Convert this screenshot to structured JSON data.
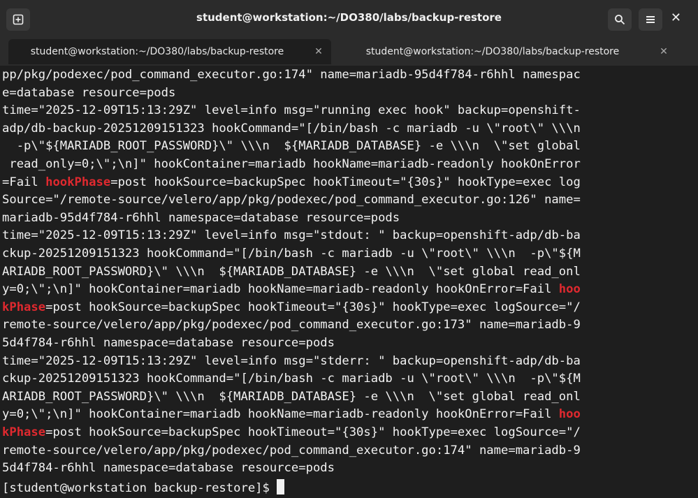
{
  "window": {
    "title": "student@workstation:~/DO380/labs/backup-restore",
    "new_tab_icon": "new-tab-icon",
    "search_icon": "search-icon",
    "menu_icon": "hamburger-menu-icon",
    "close_icon": "close-icon"
  },
  "tabs": [
    {
      "label": "student@workstation:~/DO380/labs/backup-restore",
      "active": true
    },
    {
      "label": "student@workstation:~/DO380/labs/backup-restore",
      "active": false
    }
  ],
  "terminal": {
    "lines": [
      "pp/pkg/podexec/pod_command_executor.go:174\" name=mariadb-95d4f784-r6hhl namespac",
      "e=database resource=pods",
      "time=\"2025-12-09T15:13:29Z\" level=info msg=\"running exec hook\" backup=openshift-",
      "adp/db-backup-20251209151323 hookCommand=\"[/bin/bash -c mariadb -u \\\"root\\\" \\\\\\n",
      "  -p\\\"${MARIADB_ROOT_PASSWORD}\\\" \\\\\\n  ${MARIADB_DATABASE} -e \\\\\\n  \\\"set global",
      " read_only=0;\\\";\\n]\" hookContainer=mariadb hookName=mariadb-readonly hookOnError",
      "=Fail |hookPhase|=post hookSource=backupSpec hookTimeout=\"{30s}\" hookType=exec log",
      "Source=\"/remote-source/velero/app/pkg/podexec/pod_command_executor.go:126\" name=",
      "mariadb-95d4f784-r6hhl namespace=database resource=pods",
      "time=\"2025-12-09T15:13:29Z\" level=info msg=\"stdout: \" backup=openshift-adp/db-ba",
      "ckup-20251209151323 hookCommand=\"[/bin/bash -c mariadb -u \\\"root\\\" \\\\\\n  -p\\\"${M",
      "ARIADB_ROOT_PASSWORD}\\\" \\\\\\n  ${MARIADB_DATABASE} -e \\\\\\n  \\\"set global read_onl",
      "y=0;\\\";\\n]\" hookContainer=mariadb hookName=mariadb-readonly hookOnError=Fail |hoo|",
      "|kPhase|=post hookSource=backupSpec hookTimeout=\"{30s}\" hookType=exec logSource=\"/",
      "remote-source/velero/app/pkg/podexec/pod_command_executor.go:173\" name=mariadb-9",
      "5d4f784-r6hhl namespace=database resource=pods",
      "time=\"2025-12-09T15:13:29Z\" level=info msg=\"stderr: \" backup=openshift-adp/db-ba",
      "ckup-20251209151323 hookCommand=\"[/bin/bash -c mariadb -u \\\"root\\\" \\\\\\n  -p\\\"${M",
      "ARIADB_ROOT_PASSWORD}\\\" \\\\\\n  ${MARIADB_DATABASE} -e \\\\\\n  \\\"set global read_onl",
      "y=0;\\\";\\n]\" hookContainer=mariadb hookName=mariadb-readonly hookOnError=Fail |hoo|",
      "|kPhase|=post hookSource=backupSpec hookTimeout=\"{30s}\" hookType=exec logSource=\"/",
      "remote-source/velero/app/pkg/podexec/pod_command_executor.go:174\" name=mariadb-9",
      "5d4f784-r6hhl namespace=database resource=pods"
    ],
    "prompt": "[student@workstation backup-restore]$ ",
    "highlight_color": "#e0292f"
  }
}
